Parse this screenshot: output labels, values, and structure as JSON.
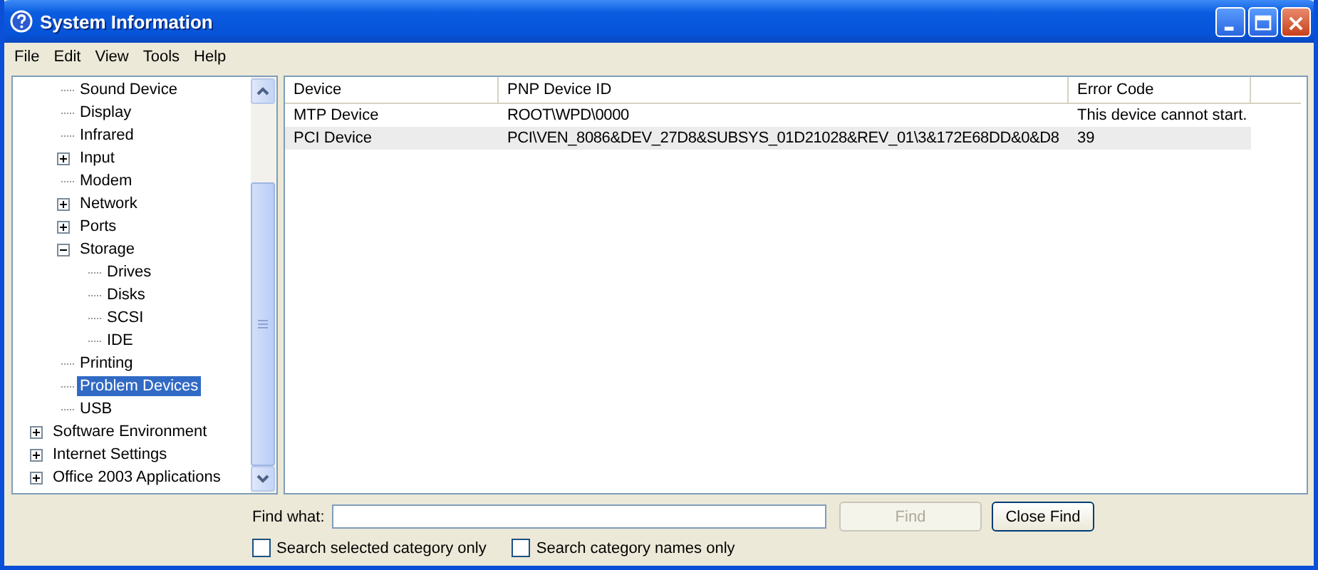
{
  "window": {
    "title": "System Information"
  },
  "menu": [
    "File",
    "Edit",
    "View",
    "Tools",
    "Help"
  ],
  "tree": {
    "continued_children": [
      {
        "label": "Sound Device",
        "selected": false
      },
      {
        "label": "Display",
        "selected": false
      },
      {
        "label": "Infrared",
        "selected": false
      },
      {
        "label": "Input",
        "selected": false,
        "expanded": false
      },
      {
        "label": "Modem",
        "selected": false
      },
      {
        "label": "Network",
        "selected": false,
        "expanded": false
      },
      {
        "label": "Ports",
        "selected": false,
        "expanded": false
      },
      {
        "label": "Storage",
        "selected": false,
        "expanded": true,
        "children": [
          {
            "label": "Drives",
            "selected": false
          },
          {
            "label": "Disks",
            "selected": false
          },
          {
            "label": "SCSI",
            "selected": false
          },
          {
            "label": "IDE",
            "selected": false
          }
        ]
      },
      {
        "label": "Printing",
        "selected": false
      },
      {
        "label": "Problem Devices",
        "selected": true
      },
      {
        "label": "USB",
        "selected": false
      }
    ],
    "items": [
      {
        "label": "Software Environment",
        "selected": false,
        "expanded": false
      },
      {
        "label": "Internet Settings",
        "selected": false,
        "expanded": false
      },
      {
        "label": "Office 2003 Applications",
        "selected": false,
        "expanded": false
      }
    ]
  },
  "table": {
    "columns": [
      "Device",
      "PNP Device ID",
      "Error Code"
    ],
    "rows": [
      {
        "selected": false,
        "cells": [
          "MTP Device",
          "ROOT\\WPD\\0000",
          "This device cannot start."
        ]
      },
      {
        "selected": true,
        "cells": [
          "PCI Device",
          "PCI\\VEN_8086&DEV_27D8&SUBSYS_01D21028&REV_01\\3&172E68DD&0&D8",
          "39"
        ]
      }
    ]
  },
  "find": {
    "label": "Find what:",
    "buttons": [
      {
        "label": "Find",
        "disabled": true
      },
      {
        "label": "Close Find",
        "disabled": false
      }
    ],
    "options": [
      {
        "label": "Search selected category only",
        "checked": false
      },
      {
        "label": "Search category names only",
        "checked": false
      }
    ]
  }
}
